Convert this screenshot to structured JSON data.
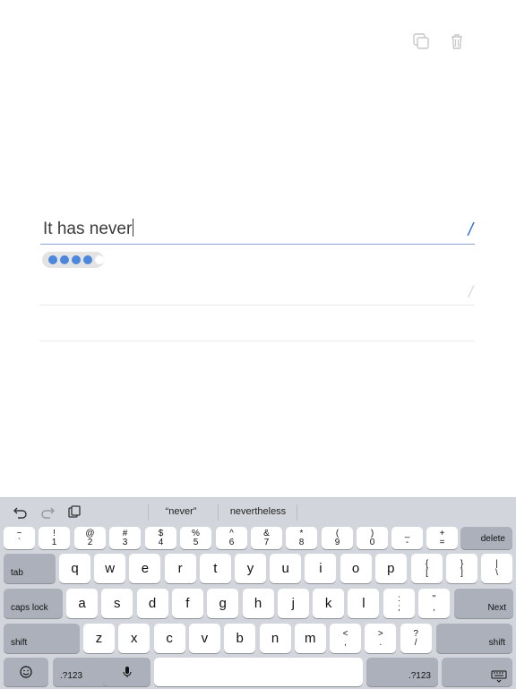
{
  "editor": {
    "active_text": "It has never",
    "row_marker": "/",
    "progress": {
      "filled": 4,
      "total": 5
    }
  },
  "keyboard": {
    "suggestions": [
      "“never”",
      "nevertheless"
    ],
    "number_row": [
      {
        "top": "~",
        "bottom": "`"
      },
      {
        "top": "!",
        "bottom": "1"
      },
      {
        "top": "@",
        "bottom": "2"
      },
      {
        "top": "#",
        "bottom": "3"
      },
      {
        "top": "$",
        "bottom": "4"
      },
      {
        "top": "%",
        "bottom": "5"
      },
      {
        "top": "^",
        "bottom": "6"
      },
      {
        "top": "&",
        "bottom": "7"
      },
      {
        "top": "*",
        "bottom": "8"
      },
      {
        "top": "(",
        "bottom": "9"
      },
      {
        "top": ")",
        "bottom": "0"
      },
      {
        "top": "_",
        "bottom": "-"
      },
      {
        "top": "+",
        "bottom": "="
      }
    ],
    "delete_label": "delete",
    "tab_label": "tab",
    "row_q": [
      "q",
      "w",
      "e",
      "r",
      "t",
      "y",
      "u",
      "i",
      "o",
      "p"
    ],
    "bracket_keys": [
      {
        "top": "{",
        "bottom": "["
      },
      {
        "top": "}",
        "bottom": "]"
      },
      {
        "top": "|",
        "bottom": "\\"
      }
    ],
    "caps_label": "caps lock",
    "row_a": [
      "a",
      "s",
      "d",
      "f",
      "g",
      "h",
      "j",
      "k",
      "l"
    ],
    "semicolon_keys": [
      {
        "top": ":",
        "bottom": ";"
      },
      {
        "top": "\"",
        "bottom": ","
      }
    ],
    "next_label": "Next",
    "shift_label": "shift",
    "row_z": [
      "z",
      "x",
      "c",
      "v",
      "b",
      "n",
      "m"
    ],
    "punct_keys": [
      {
        "top": "<",
        "bottom": ","
      },
      {
        "top": ">",
        "bottom": "."
      },
      {
        "top": "?",
        "bottom": "/"
      }
    ],
    "numbers_label": ".?123"
  }
}
